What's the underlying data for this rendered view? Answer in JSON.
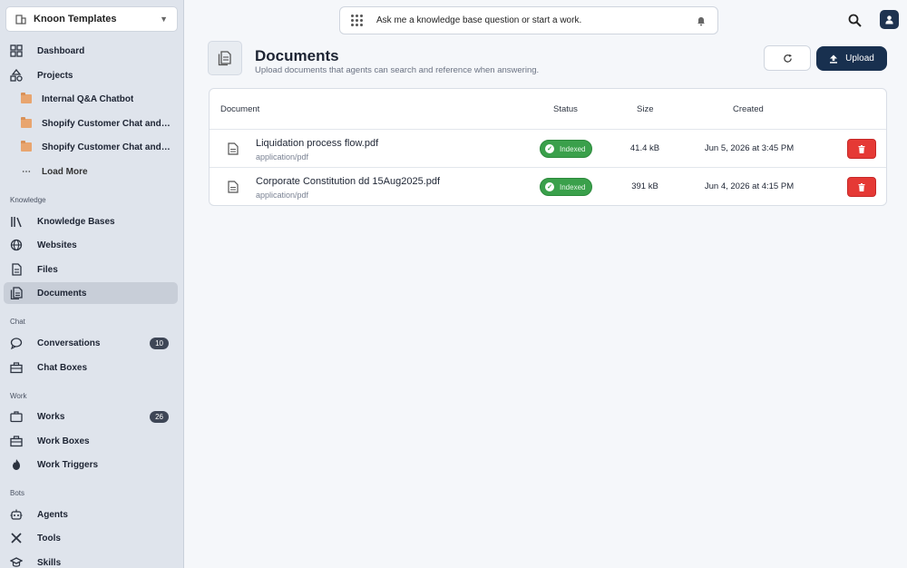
{
  "workspace": {
    "name": "Knoon Templates"
  },
  "sidebar": {
    "main": [
      {
        "label": "Dashboard",
        "icon": "dashboard-icon"
      },
      {
        "label": "Projects",
        "icon": "projects-icon"
      }
    ],
    "projects": [
      {
        "label": "Internal Q&A Chatbot"
      },
      {
        "label": "Shopify Customer Chat and Order Support"
      },
      {
        "label": "Shopify Customer Chat and Order Tracking"
      }
    ],
    "load_more": "Load More",
    "sections": {
      "knowledge": "Knowledge",
      "chat": "Chat",
      "work": "Work",
      "bots": "Bots"
    },
    "knowledge_items": [
      {
        "label": "Knowledge Bases"
      },
      {
        "label": "Websites"
      },
      {
        "label": "Files"
      },
      {
        "label": "Documents"
      }
    ],
    "chat_items": [
      {
        "label": "Conversations",
        "badge": "10"
      },
      {
        "label": "Chat Boxes"
      }
    ],
    "work_items": [
      {
        "label": "Works",
        "badge": "26"
      },
      {
        "label": "Work Boxes"
      },
      {
        "label": "Work Triggers"
      }
    ],
    "bot_items": [
      {
        "label": "Agents"
      },
      {
        "label": "Tools"
      },
      {
        "label": "Skills"
      }
    ]
  },
  "ask": {
    "value": "Ask me a knowledge base question or start a work."
  },
  "header": {
    "title": "Documents",
    "subtitle": "Upload documents that agents can search and reference when answering.",
    "upload_label": "Upload"
  },
  "table": {
    "columns": {
      "document": "Document",
      "status": "Status",
      "size": "Size",
      "created": "Created"
    },
    "rows": [
      {
        "name": "Liquidation process flow.pdf",
        "type": "application/pdf",
        "status": "Indexed",
        "size": "41.4 kB",
        "created": "Jun 5, 2026 at 3:45 PM"
      },
      {
        "name": "Corporate Constitution dd 15Aug2025.pdf",
        "type": "application/pdf",
        "status": "Indexed",
        "size": "391 kB",
        "created": "Jun 4, 2026 at 4:15 PM"
      }
    ]
  },
  "colors": {
    "accent": "#18304f",
    "status_green": "#3aa04b",
    "danger": "#e53935"
  }
}
